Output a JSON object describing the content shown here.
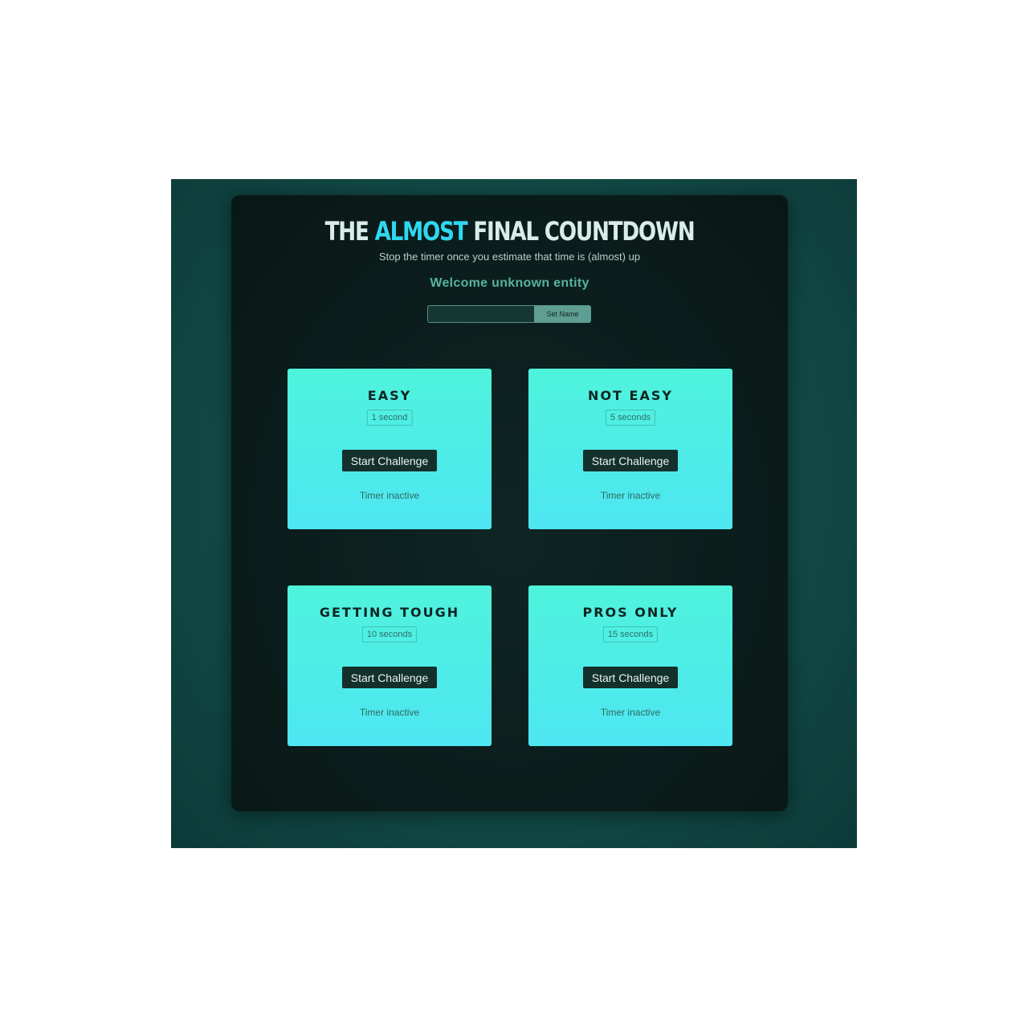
{
  "header": {
    "title_part1": "THE ",
    "title_accent": "ALMOST",
    "title_part2": " FINAL COUNTDOWN",
    "subtitle": "Stop the timer once you estimate that time is (almost) up",
    "welcome": "Welcome unknown entity"
  },
  "name_form": {
    "input_value": "",
    "button_label": "Set Name"
  },
  "challenges": [
    {
      "title": "EASY",
      "duration": "1 second",
      "button_label": "Start Challenge",
      "status": "Timer inactive"
    },
    {
      "title": "NOT EASY",
      "duration": "5 seconds",
      "button_label": "Start Challenge",
      "status": "Timer inactive"
    },
    {
      "title": "GETTING TOUGH",
      "duration": "10 seconds",
      "button_label": "Start Challenge",
      "status": "Timer inactive"
    },
    {
      "title": "PROS ONLY",
      "duration": "15 seconds",
      "button_label": "Start Challenge",
      "status": "Timer inactive"
    }
  ],
  "colors": {
    "background": "#124a46",
    "panel": "#0a1b1a",
    "accent": "#2fd8f0",
    "card_top": "#4ff3dc",
    "card_bottom": "#4ee6f2",
    "button": "#14302d",
    "welcome_text": "#57b3a0"
  }
}
